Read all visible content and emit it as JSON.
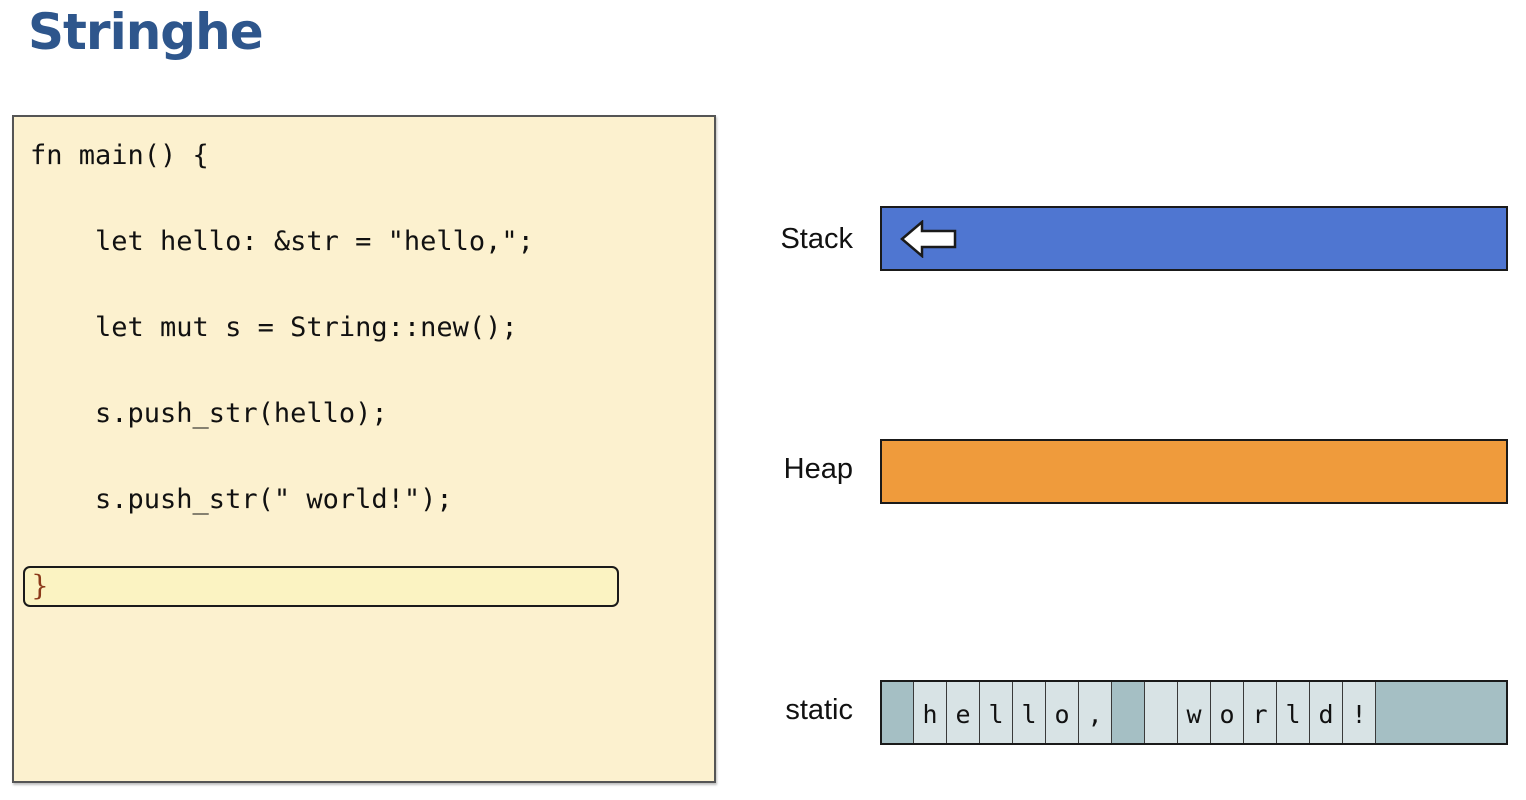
{
  "title": "Stringhe",
  "code": {
    "lines": [
      "fn main() {",
      "    let hello: &str = \"hello,\";",
      "    let mut s = String::new();",
      "    s.push_str(hello);",
      "    s.push_str(\" world!\");"
    ],
    "closing_brace": "}"
  },
  "memory": {
    "stack_label": "Stack",
    "heap_label": "Heap",
    "static_label": "static",
    "static_cells": [
      "",
      "h",
      "e",
      "l",
      "l",
      "o",
      ",",
      "",
      "",
      "w",
      "o",
      "r",
      "l",
      "d",
      "!"
    ]
  },
  "colors": {
    "title": "#2e568c",
    "code_bg": "#fcf1cf",
    "stack": "#4f76d1",
    "heap": "#ef9b3c",
    "static": "#a5bfc4",
    "static_cell": "#d8e3e5"
  },
  "icons": {
    "stack_pointer": "left-arrow-icon"
  }
}
